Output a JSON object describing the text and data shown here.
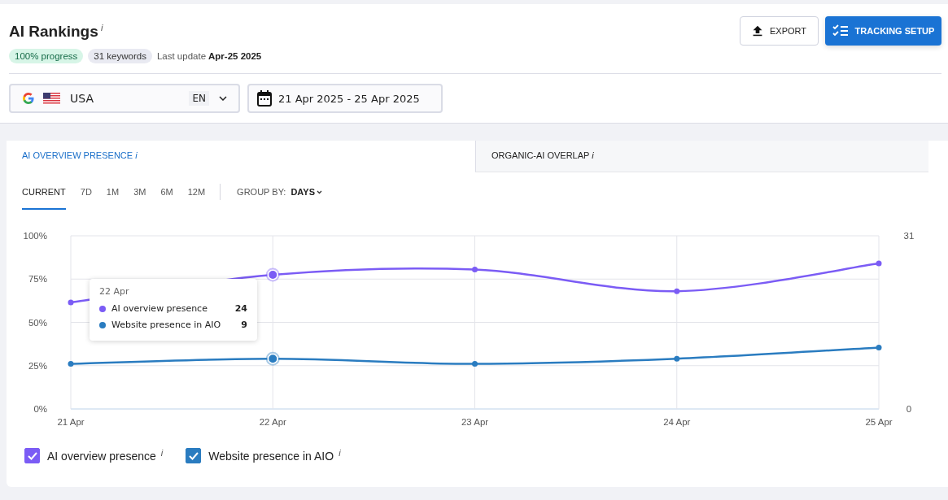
{
  "header": {
    "title": "AI Rankings",
    "info": "i",
    "badges": [
      {
        "label": "100% progress",
        "kind": "success"
      },
      {
        "label": "31 keywords",
        "kind": "neutral"
      }
    ],
    "last_update_label": "Last update",
    "last_update_value": "Apr-25 2025"
  },
  "buttons": [
    {
      "label": "EXPORT",
      "kind": "secondary"
    },
    {
      "label": "TRACKING SETUP",
      "kind": "primary"
    }
  ],
  "filters": {
    "location": "USA",
    "language": "EN",
    "date_range": "21 Apr 2025 - 25 Apr 2025"
  },
  "tabs": [
    {
      "label": "AI OVERVIEW PRESENCE",
      "info": "i",
      "selected": true
    },
    {
      "label": "ORGANIC-AI OVERLAP",
      "info": "i",
      "selected": false
    }
  ],
  "periods": [
    {
      "label": "CURRENT",
      "selected": true
    },
    {
      "label": "7D",
      "selected": false
    },
    {
      "label": "1M",
      "selected": false
    },
    {
      "label": "3M",
      "selected": false
    },
    {
      "label": "6M",
      "selected": false
    },
    {
      "label": "12M",
      "selected": false
    }
  ],
  "group_by": {
    "label": "GROUP BY:",
    "value": "DAYS"
  },
  "chart": {
    "chart_data": {
      "type": "line",
      "grid": true,
      "legend": true,
      "categories": [
        "21 Apr",
        "22 Apr",
        "23 Apr",
        "24 Apr",
        "25 Apr"
      ],
      "ylim": [
        0,
        100
      ],
      "yticks": [
        {
          "value": 0,
          "label": "0%"
        },
        {
          "value": 25,
          "label": "25%"
        },
        {
          "value": 50,
          "label": "50%"
        },
        {
          "value": 75,
          "label": "75%"
        },
        {
          "value": 100,
          "label": "100%"
        }
      ],
      "series": [
        {
          "name": "AI overview presence",
          "color": "#7b5cf5",
          "marker": "circle",
          "values": [
            61.5,
            77.5,
            80.5,
            68,
            84
          ]
        },
        {
          "name": "Website presence in AIO",
          "color": "#2a7cc0",
          "marker": "circle",
          "values": [
            26,
            29,
            26,
            29,
            35.5
          ]
        }
      ]
    },
    "right_axis_labels": [
      "31",
      "0"
    ],
    "highlighted_points": [
      false,
      true,
      false,
      false,
      false
    ],
    "tooltip": {
      "title": "22 Apr",
      "rows": [
        {
          "label": "AI overview presence",
          "value": "24",
          "color": "#7b5cf5"
        },
        {
          "label": "Website presence in AIO",
          "value": "9",
          "color": "#2a7cc0"
        }
      ]
    }
  },
  "legend": [
    {
      "info": "i",
      "checked": true
    },
    {
      "info": "i",
      "checked": true
    }
  ]
}
